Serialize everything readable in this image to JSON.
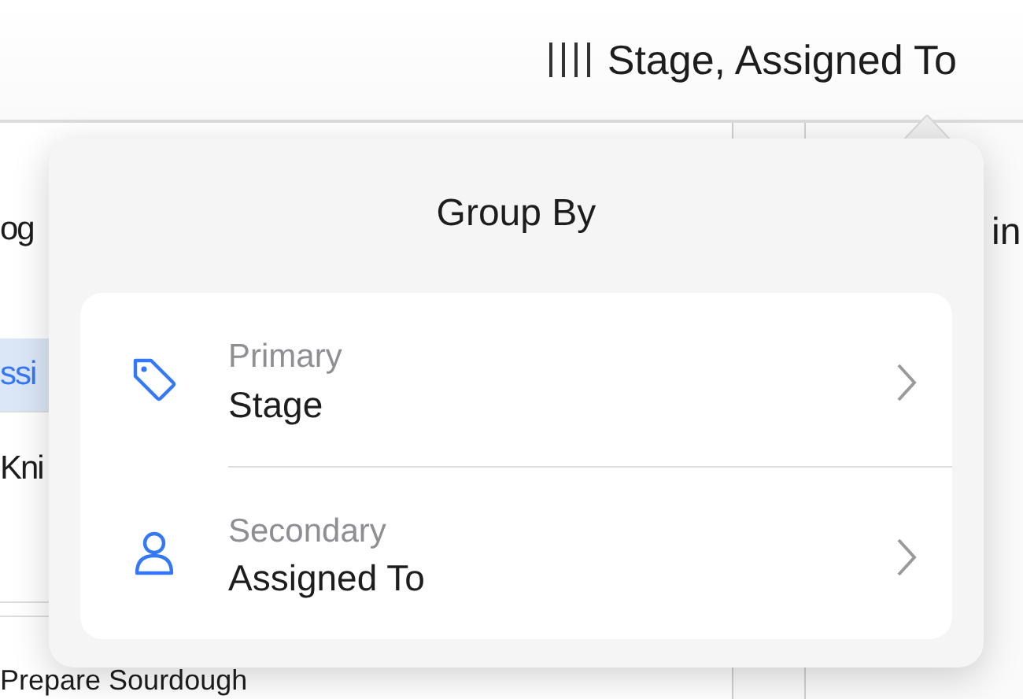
{
  "toolbar": {
    "group_label": "Stage, Assigned To"
  },
  "background": {
    "left_items": [
      {
        "label": "og",
        "selected": false
      },
      {
        "label": "ssi",
        "selected": true
      },
      {
        "label": "Kni",
        "selected": false
      },
      {
        "label": "Prepare Sourdough",
        "selected": false
      }
    ],
    "right_heading": "in"
  },
  "popover": {
    "title": "Group By",
    "options": [
      {
        "kind": "tag",
        "caption": "Primary",
        "value": "Stage"
      },
      {
        "kind": "person",
        "caption": "Secondary",
        "value": "Assigned To"
      }
    ]
  }
}
